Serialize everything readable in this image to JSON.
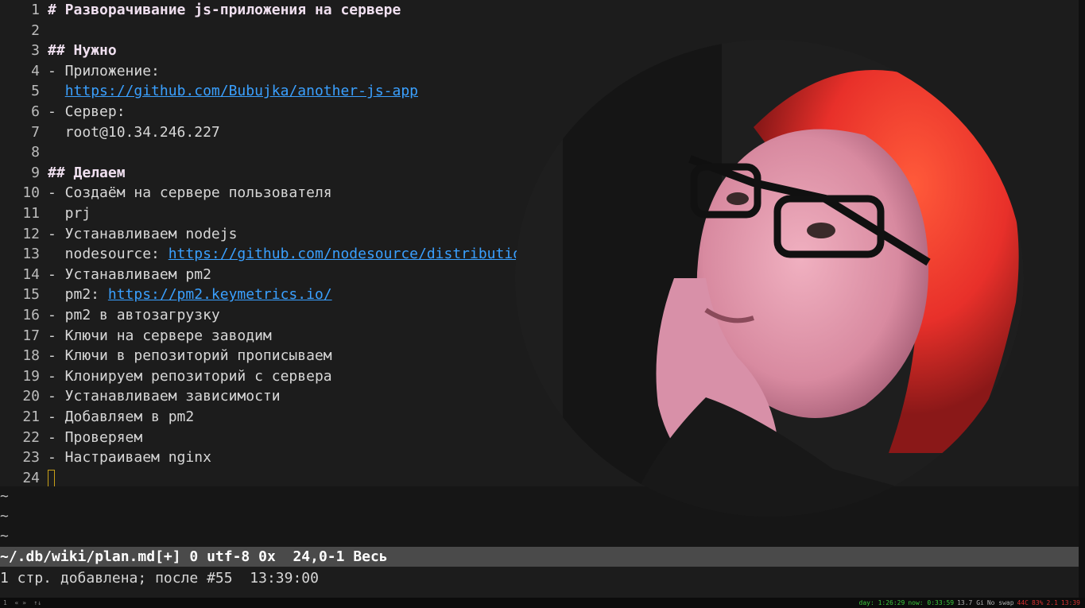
{
  "editor": {
    "lines": [
      {
        "num": "1",
        "parts": [
          {
            "t": "# Разворачивание js-приложения на сервере",
            "c": "hdr"
          }
        ]
      },
      {
        "num": "2",
        "parts": []
      },
      {
        "num": "3",
        "parts": [
          {
            "t": "## Нужно",
            "c": "hdr"
          }
        ]
      },
      {
        "num": "4",
        "parts": [
          {
            "t": "- Приложение:",
            "c": "txt"
          }
        ]
      },
      {
        "num": "5",
        "parts": [
          {
            "t": "  ",
            "c": "txt"
          },
          {
            "t": "https://github.com/Bubujka/another-js-app",
            "c": "url"
          }
        ]
      },
      {
        "num": "6",
        "parts": [
          {
            "t": "- Сервер:",
            "c": "txt"
          }
        ]
      },
      {
        "num": "7",
        "parts": [
          {
            "t": "  root@10.34.246.227",
            "c": "txt"
          }
        ]
      },
      {
        "num": "8",
        "parts": []
      },
      {
        "num": "9",
        "parts": [
          {
            "t": "## Делаем",
            "c": "hdr"
          }
        ]
      },
      {
        "num": "10",
        "parts": [
          {
            "t": "- Создаём на сервере пользователя",
            "c": "txt"
          }
        ]
      },
      {
        "num": "11",
        "parts": [
          {
            "t": "  prj",
            "c": "txt"
          }
        ]
      },
      {
        "num": "12",
        "parts": [
          {
            "t": "- Устанавливаем nodejs",
            "c": "txt"
          }
        ]
      },
      {
        "num": "13",
        "parts": [
          {
            "t": "  nodesource: ",
            "c": "txt"
          },
          {
            "t": "https://github.com/nodesource/distributions",
            "c": "url"
          }
        ]
      },
      {
        "num": "14",
        "parts": [
          {
            "t": "- Устанавливаем pm2",
            "c": "txt"
          }
        ]
      },
      {
        "num": "15",
        "parts": [
          {
            "t": "  pm2: ",
            "c": "txt"
          },
          {
            "t": "https://pm2.keymetrics.io/",
            "c": "url"
          }
        ]
      },
      {
        "num": "16",
        "parts": [
          {
            "t": "- pm2 в автозагрузку",
            "c": "txt"
          }
        ]
      },
      {
        "num": "17",
        "parts": [
          {
            "t": "- Ключи на сервере заводим",
            "c": "txt"
          }
        ]
      },
      {
        "num": "18",
        "parts": [
          {
            "t": "- Ключи в репозиторий прописываем",
            "c": "txt"
          }
        ]
      },
      {
        "num": "19",
        "parts": [
          {
            "t": "- Клонируем репозиторий с сервера",
            "c": "txt"
          }
        ]
      },
      {
        "num": "20",
        "parts": [
          {
            "t": "- Устанавливаем зависимости",
            "c": "txt"
          }
        ]
      },
      {
        "num": "21",
        "parts": [
          {
            "t": "- Добавляем в pm2",
            "c": "txt"
          }
        ]
      },
      {
        "num": "22",
        "parts": [
          {
            "t": "- Проверяем",
            "c": "txt"
          }
        ]
      },
      {
        "num": "23",
        "parts": [
          {
            "t": "- Настраиваем nginx",
            "c": "txt"
          }
        ]
      },
      {
        "num": "24",
        "parts": [],
        "cursor": true
      }
    ],
    "tilde": "~"
  },
  "statusline": "~/.db/wiki/plan.md[+] 0 utf-8 0x  24,0-1 Весь",
  "cmdline": "1 стр. добавлена; после #55  13:39:00",
  "taskbar": {
    "left": "1  « »  ↑↓",
    "right": [
      {
        "t": "day: 1:26:29",
        "c": "g"
      },
      {
        "t": "now: 0:33:59",
        "c": "g"
      },
      {
        "t": "13.7 Gi",
        "c": "w"
      },
      {
        "t": "No swap",
        "c": "w"
      },
      {
        "t": "44C",
        "c": "r"
      },
      {
        "t": "83%",
        "c": "r"
      },
      {
        "t": "2.1",
        "c": "r"
      },
      {
        "t": "13:39",
        "c": "r"
      }
    ]
  },
  "colors": {
    "url": "#3aa0ff",
    "header": "#f0e0f0",
    "cursor": "#c8a018",
    "status_bg": "#4a4a4a"
  }
}
